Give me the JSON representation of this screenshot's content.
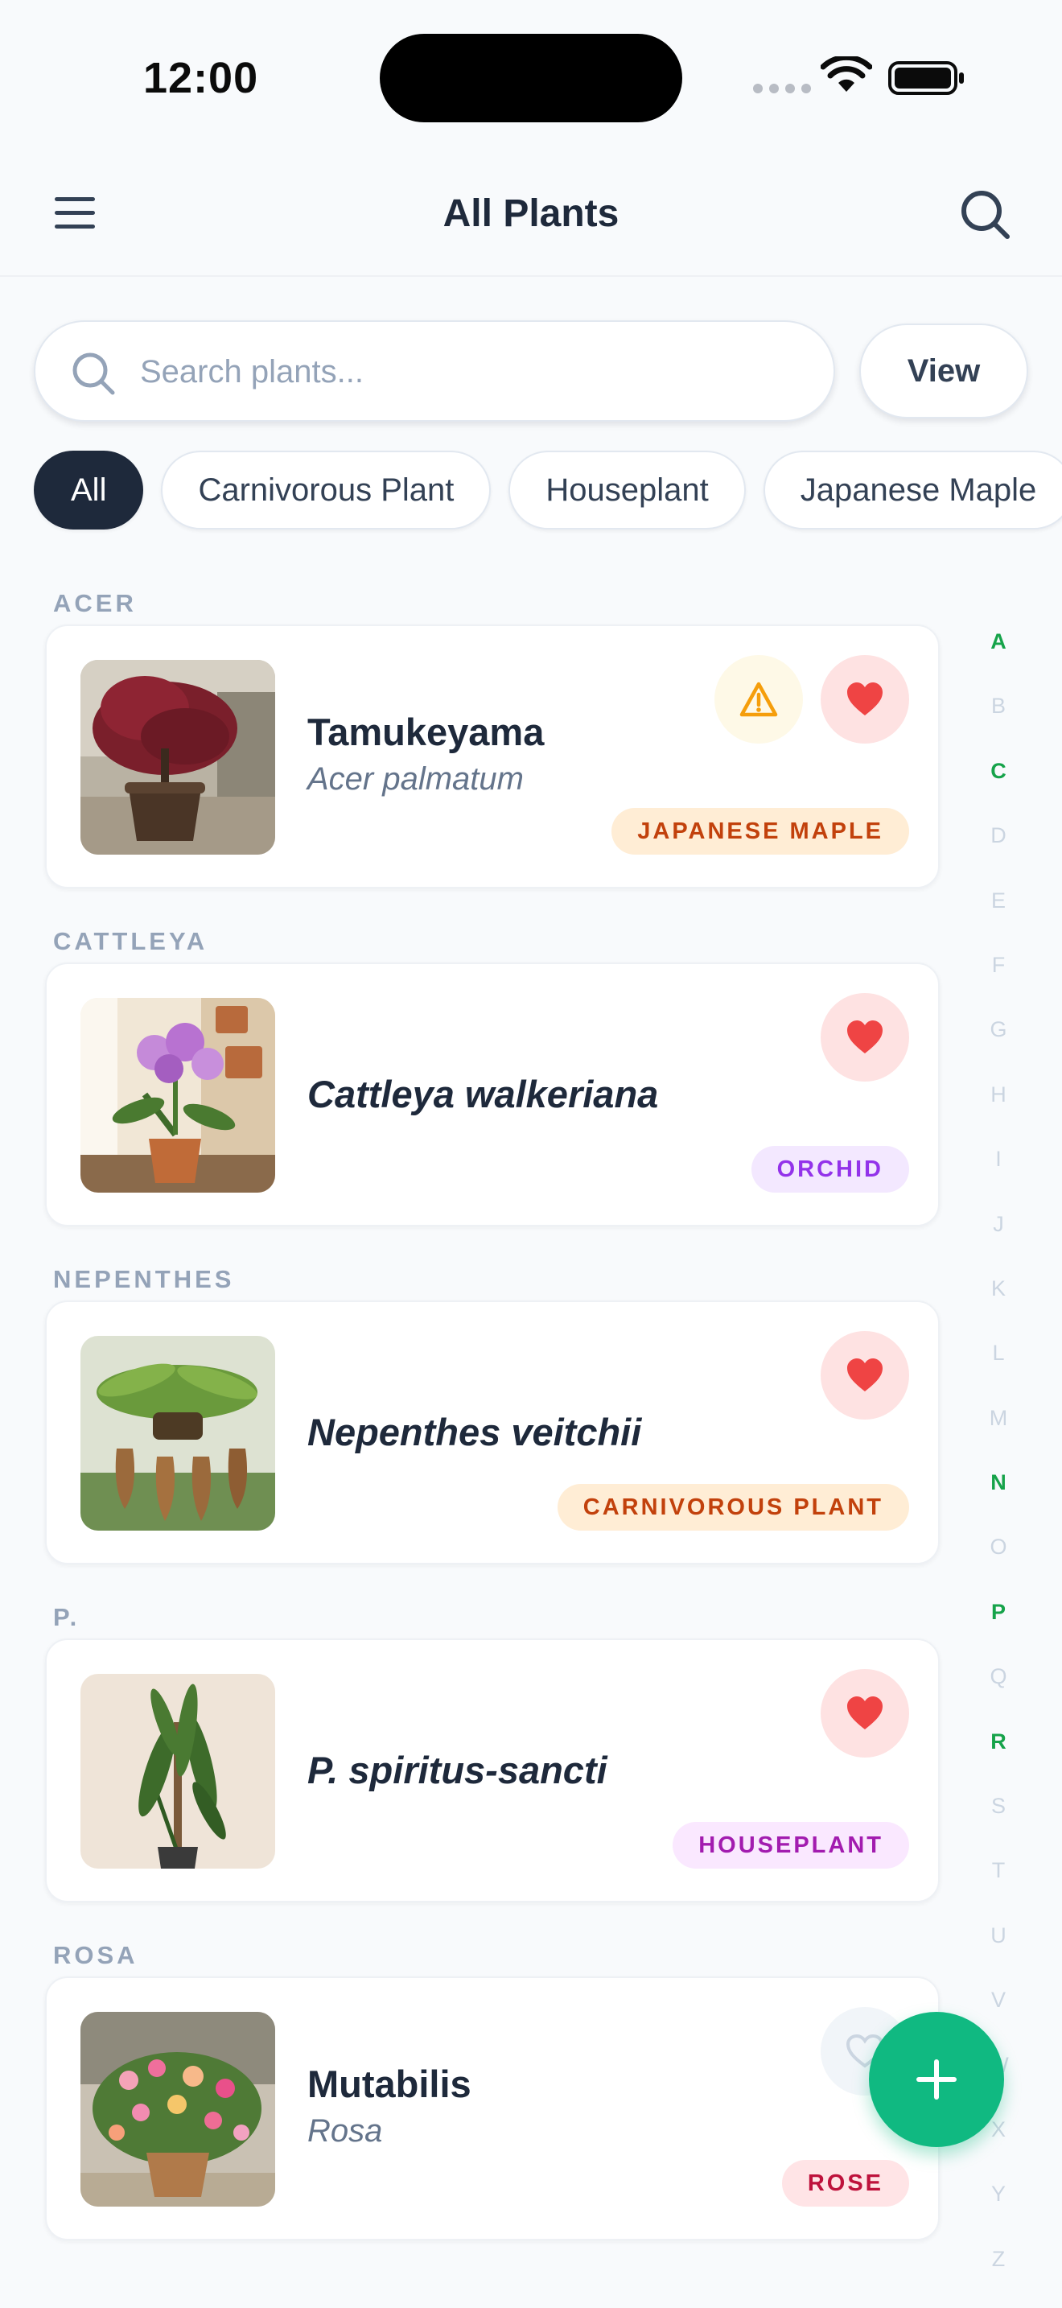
{
  "status_bar": {
    "time": "12:00"
  },
  "header": {
    "title": "All Plants"
  },
  "search": {
    "placeholder": "Search plants...",
    "view_label": "View"
  },
  "filters": [
    "All",
    "Carnivorous Plant",
    "Houseplant",
    "Japanese Maple"
  ],
  "sections": [
    {
      "label": "ACER",
      "plant": {
        "name": "Tamukeyama",
        "scientific": "Acer palmatum",
        "tag": "JAPANESE MAPLE",
        "favorite": true,
        "warning": true
      }
    },
    {
      "label": "CATTLEYA",
      "plant": {
        "name": "Cattleya walkeriana",
        "scientific": "",
        "tag": "ORCHID",
        "favorite": true,
        "warning": false
      }
    },
    {
      "label": "NEPENTHES",
      "plant": {
        "name": "Nepenthes veitchii",
        "scientific": "",
        "tag": "CARNIVOROUS PLANT",
        "favorite": true,
        "warning": false
      }
    },
    {
      "label": "P.",
      "plant": {
        "name": "P. spiritus-sancti",
        "scientific": "",
        "tag": "HOUSEPLANT",
        "favorite": true,
        "warning": false
      }
    },
    {
      "label": "ROSA",
      "plant": {
        "name": "Mutabilis",
        "scientific": "Rosa",
        "tag": "ROSE",
        "favorite": false,
        "warning": false
      }
    }
  ],
  "alphabet_index": [
    "A",
    "B",
    "C",
    "D",
    "E",
    "F",
    "G",
    "H",
    "I",
    "J",
    "K",
    "L",
    "M",
    "N",
    "O",
    "P",
    "Q",
    "R",
    "S",
    "T",
    "U",
    "V",
    "W",
    "X",
    "Y",
    "Z"
  ],
  "alphabet_active": [
    "A",
    "C",
    "N",
    "P",
    "R"
  ],
  "colors": {
    "accent": "#10b981",
    "active_letter": "#16a34a",
    "favorite_heart": "#ef4444",
    "tag_japanese_maple": "#c2410c",
    "tag_orchid": "#9333ea",
    "tag_carnivorous": "#c2410c",
    "tag_houseplant": "#a21caf",
    "tag_rose": "#be123c"
  },
  "icons": [
    "menu-icon",
    "search-icon",
    "warning-icon",
    "heart-icon",
    "plus-icon",
    "wifi-icon",
    "battery-icon"
  ]
}
